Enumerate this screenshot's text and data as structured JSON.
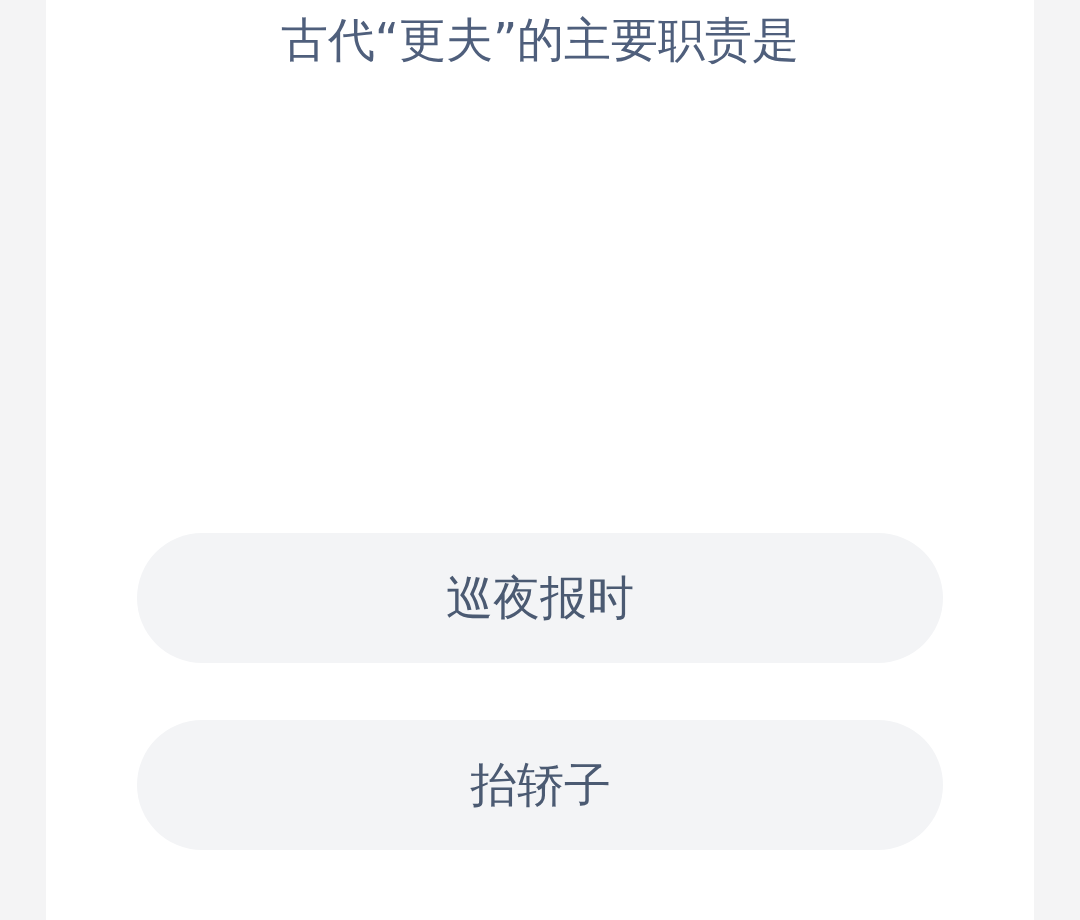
{
  "question": "古代“更夫”的主要职责是",
  "options": [
    {
      "label": "巡夜报时"
    },
    {
      "label": "抬轿子"
    }
  ]
}
